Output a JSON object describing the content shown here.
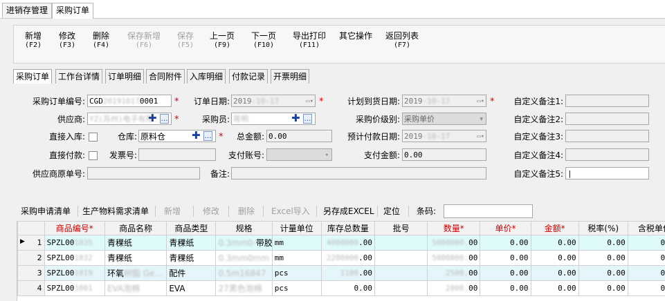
{
  "module_tabs": [
    "进销存管理",
    "采购订单"
  ],
  "toolbar": [
    {
      "label": "新增",
      "key": "(F2)",
      "disabled": false
    },
    {
      "label": "修改",
      "key": "(F3)",
      "disabled": false
    },
    {
      "label": "删除",
      "key": "(F4)",
      "disabled": false
    },
    {
      "label": "保存新增",
      "key": "(F6)",
      "disabled": true
    },
    {
      "label": "保存",
      "key": "(F5)",
      "disabled": true
    },
    {
      "label": "上一页",
      "key": "(F9)",
      "disabled": false
    },
    {
      "label": "下一页",
      "key": "(F10)",
      "disabled": false
    },
    {
      "label": "导出打印",
      "key": "(F11)",
      "disabled": false
    },
    {
      "label": "其它操作",
      "key": "",
      "disabled": false
    },
    {
      "label": "返回列表",
      "key": "(F7)",
      "disabled": false
    }
  ],
  "sub_tabs": [
    "采购订单",
    "工作台详情",
    "订单明细",
    "合同附件",
    "入库明细",
    "付款记录",
    "开票明细"
  ],
  "form": {
    "order_no_label": "采购订单编号:",
    "order_no_value": "CGD",
    "order_no_tail": "0001",
    "order_date_label": "订单日期:",
    "order_date_value": "2019",
    "plan_date_label": "计划到货日期:",
    "plan_date_value": "2019",
    "custom1_label": "自定义备注1:",
    "supplier_label": "供应商:",
    "buyer_label": "采购员:",
    "price_level_label": "采购价级别:",
    "price_level_value": "采购单价",
    "custom2_label": "自定义备注2:",
    "direct_in_label": "直接入库:",
    "warehouse_label": "仓库:",
    "warehouse_value": "原料仓",
    "total_label": "总金额:",
    "total_value": "0.00",
    "expected_pay_date_label": "预计付款日期:",
    "expected_pay_date_value": "2019",
    "custom3_label": "自定义备注3:",
    "direct_pay_label": "直接付款:",
    "invoice_no_label": "发票号:",
    "pay_account_label": "支付账号:",
    "pay_amount_label": "支付金额:",
    "pay_amount_value": "0.00",
    "custom4_label": "自定义备注4:",
    "supplier_orig_label": "供应商原单号:",
    "remark_label": "备注:",
    "custom5_label": "自定义备注5:"
  },
  "grid_toolbar": [
    {
      "label": "采购申请清单",
      "disabled": false
    },
    {
      "label": "生产物料需求清单",
      "disabled": false
    },
    {
      "label": "新增",
      "disabled": true
    },
    {
      "label": "修改",
      "disabled": true
    },
    {
      "label": "删除",
      "disabled": true
    },
    {
      "label": "Excel导入",
      "disabled": true
    },
    {
      "label": "另存成EXCEL",
      "disabled": false
    },
    {
      "label": "定位",
      "disabled": false
    }
  ],
  "barcode_label": "条码:",
  "table": {
    "headers": [
      "商品编号*",
      "商品名称",
      "商品类型",
      "规格",
      "计量单位",
      "库存总数量",
      "批号",
      "数量*",
      "单价*",
      "金额*",
      "税率(%)",
      "含税单价"
    ],
    "rows": [
      {
        "idx": "1",
        "code": "SPZL00",
        "name": "青稞纸",
        "type": "青稞纸",
        "spec": "带胶",
        "unit": "mm",
        "stock": ".00",
        "batch": "",
        "qty": "00",
        "price": "0.00",
        "amount": "0.00",
        "tax": "0.00",
        "taxprice": "0.00"
      },
      {
        "idx": "2",
        "code": "SPZL00",
        "name": "青稞纸",
        "type": "青稞纸",
        "spec": "",
        "unit": "mm",
        "stock": ".00",
        "batch": "",
        "qty": "00",
        "price": "0.00",
        "amount": "0.00",
        "tax": "0.00",
        "taxprice": "0.00"
      },
      {
        "idx": "3",
        "code": "SPZL00",
        "name": "环氧",
        "type": "配件",
        "spec": "",
        "unit": "pcs",
        "stock": ".00",
        "batch": "",
        "qty": "00",
        "price": "0.00",
        "amount": "0.00",
        "tax": "0.00",
        "taxprice": "0.00"
      },
      {
        "idx": "4",
        "code": "SPZL00",
        "name": "",
        "type": "EVA",
        "spec": "",
        "unit": "pcs",
        "stock": "0.00",
        "batch": "",
        "qty": "00",
        "price": "0.00",
        "amount": "0.00",
        "tax": "0.00",
        "taxprice": "0.00"
      }
    ]
  }
}
